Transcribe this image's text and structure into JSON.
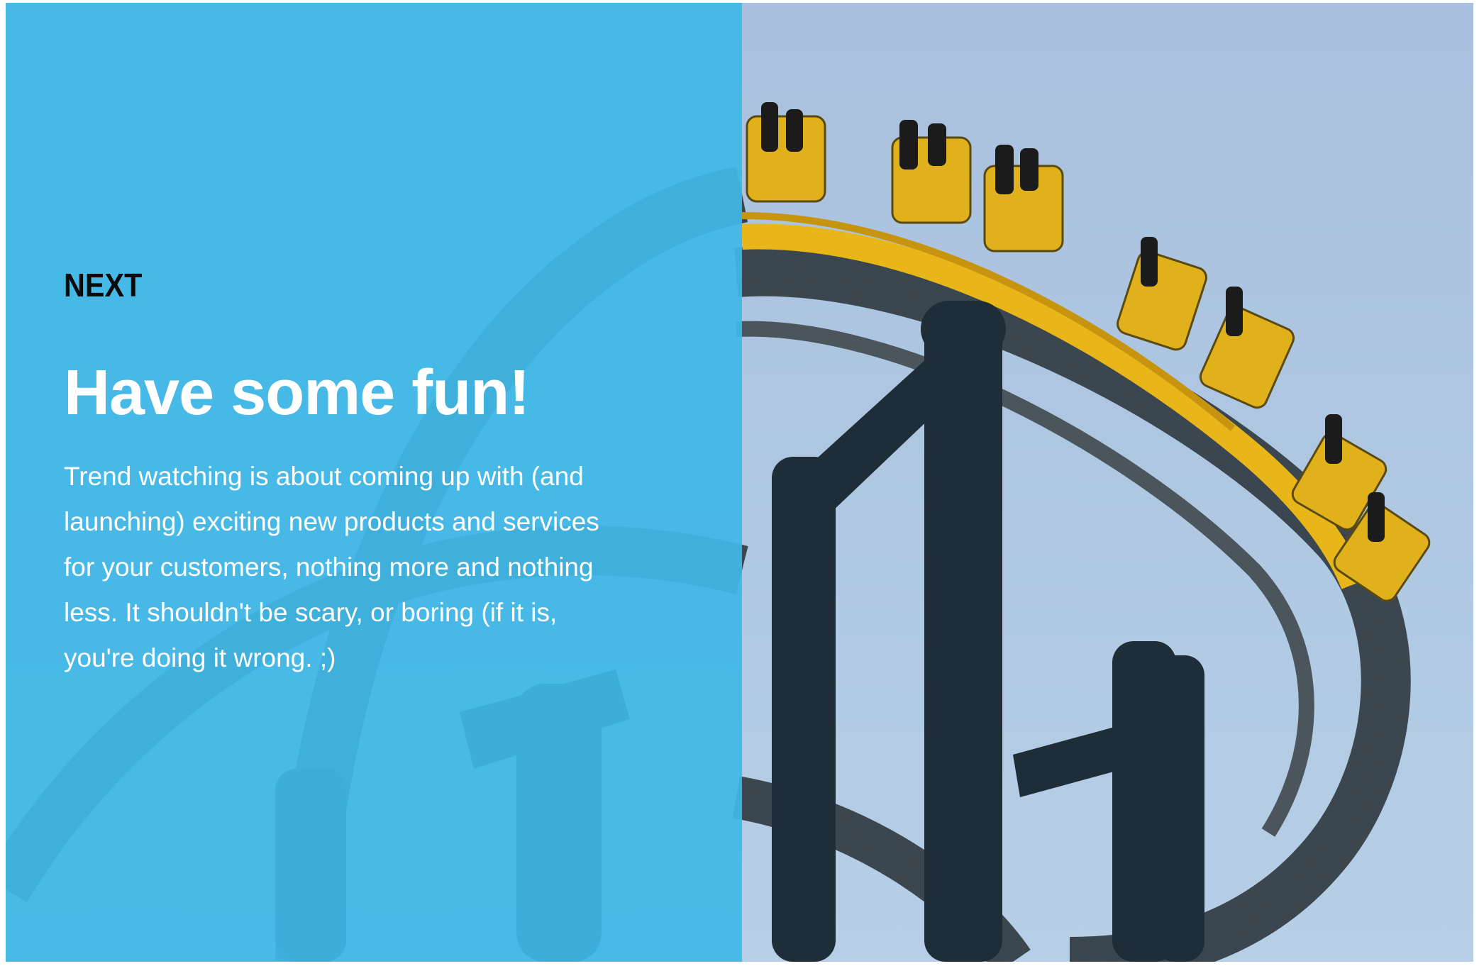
{
  "slide": {
    "eyebrow": "NEXT",
    "headline": "Have some fun!",
    "body": "Trend watching is about coming up with (and launching) exciting new products and services for your customers, nothing more and nothing less. It shouldn't be scary, or boring (if it is, you're doing it wrong. ;)"
  },
  "colors": {
    "overlay": "#40b8e6",
    "sky": "#a9c3df",
    "track_steel": "#1f2d38",
    "train_yellow": "#e8b619",
    "eyebrow_text": "#0b0b0b",
    "headline_text": "#ffffff"
  }
}
